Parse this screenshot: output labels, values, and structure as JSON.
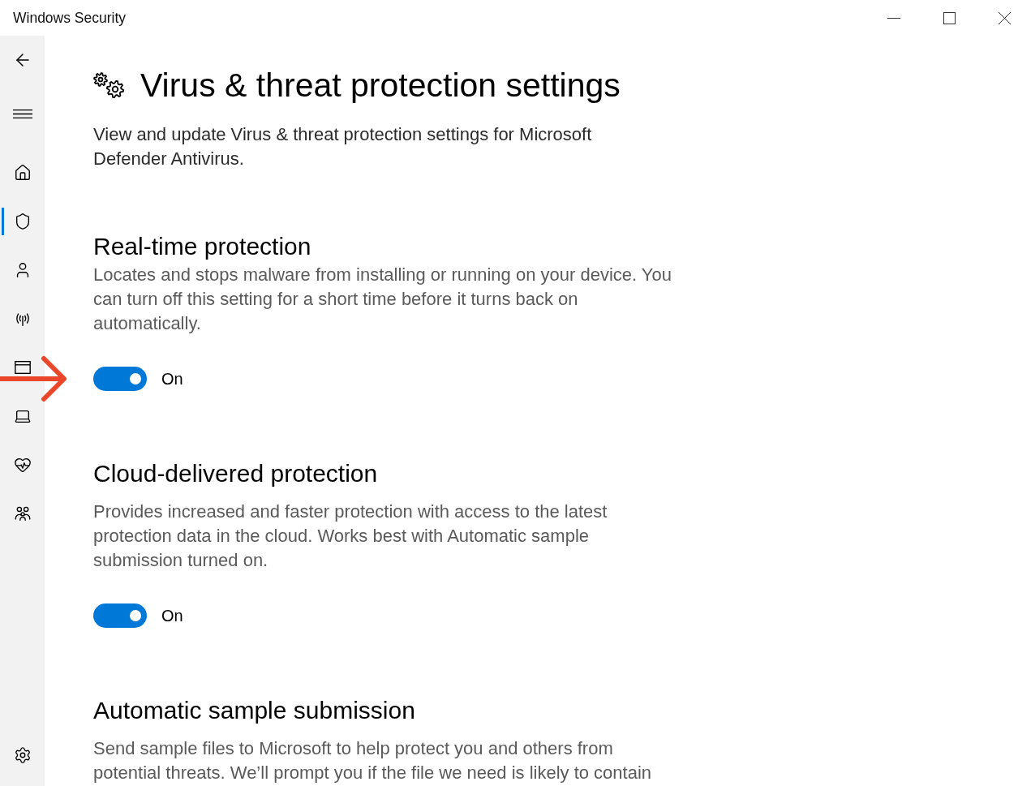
{
  "window": {
    "title": "Windows Security"
  },
  "sidebar": {
    "items": [
      {
        "kind": "home",
        "selected": false
      },
      {
        "kind": "shield",
        "selected": true
      },
      {
        "kind": "account",
        "selected": false
      },
      {
        "kind": "network",
        "selected": false
      },
      {
        "kind": "app_browser",
        "selected": false
      },
      {
        "kind": "device",
        "selected": false
      },
      {
        "kind": "health",
        "selected": false
      },
      {
        "kind": "family",
        "selected": false
      }
    ],
    "bottom_items": [
      {
        "kind": "settings",
        "selected": false
      }
    ]
  },
  "page": {
    "title": "Virus & threat protection settings",
    "description": "View and update Virus & threat protection settings for Microsoft Defender Antivirus."
  },
  "sections": [
    {
      "heading": "Real-time protection",
      "description": "Locates and stops malware from installing or running on your device. You can turn off this setting for a short time before it turns back on automatically.",
      "toggle": {
        "on": true,
        "label": "On"
      }
    },
    {
      "heading": "Cloud-delivered protection",
      "description": "Provides increased and faster protection with access to the latest protection data in the cloud. Works best with Automatic sample submission turned on.",
      "toggle": {
        "on": true,
        "label": "On"
      }
    },
    {
      "heading": "Automatic sample submission",
      "description": "Send sample files to Microsoft to help protect you and others from potential threats. We’ll prompt you if the file we need is likely to contain"
    }
  ],
  "annotations": [
    {
      "kind": "arrow"
    }
  ]
}
